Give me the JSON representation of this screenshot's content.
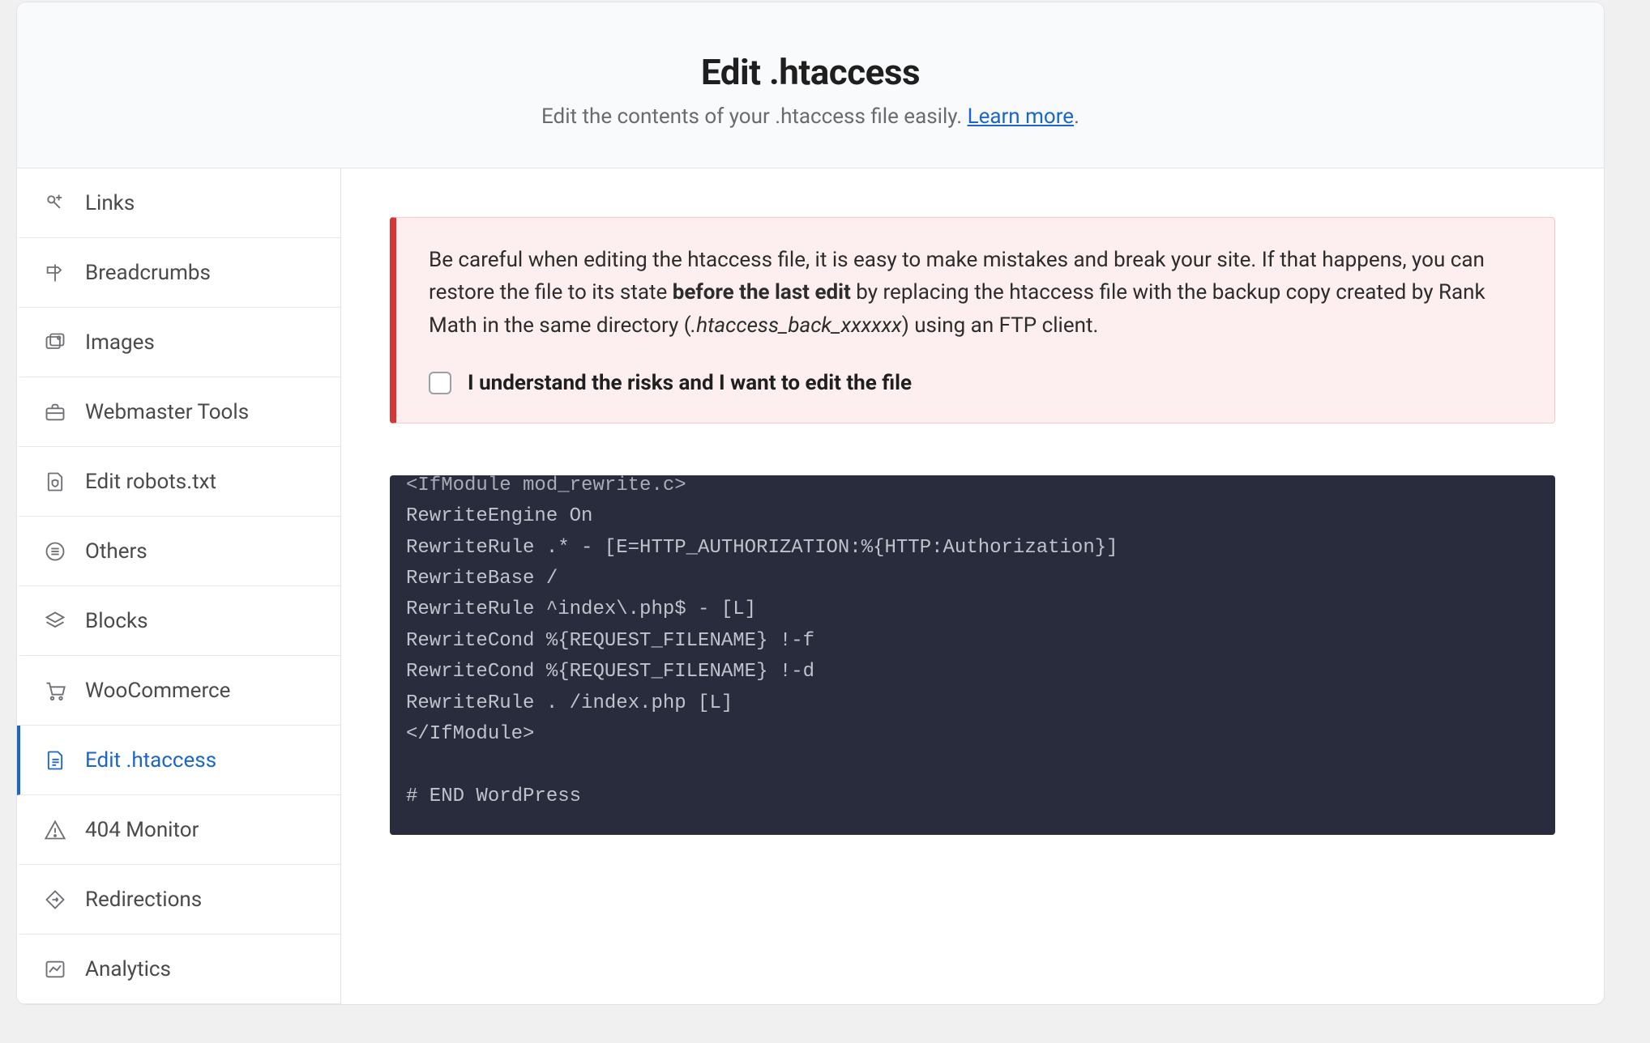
{
  "header": {
    "title": "Edit .htaccess",
    "subtitle_prefix": "Edit the contents of your .htaccess file easily. ",
    "learn_more": "Learn more",
    "subtitle_suffix": "."
  },
  "sidebar": {
    "items": [
      {
        "id": "links",
        "label": "Links"
      },
      {
        "id": "breadcrumbs",
        "label": "Breadcrumbs"
      },
      {
        "id": "images",
        "label": "Images"
      },
      {
        "id": "webmaster-tools",
        "label": "Webmaster Tools"
      },
      {
        "id": "edit-robots",
        "label": "Edit robots.txt"
      },
      {
        "id": "others",
        "label": "Others"
      },
      {
        "id": "blocks",
        "label": "Blocks"
      },
      {
        "id": "woocommerce",
        "label": "WooCommerce"
      },
      {
        "id": "edit-htaccess",
        "label": "Edit .htaccess"
      },
      {
        "id": "404-monitor",
        "label": "404 Monitor"
      },
      {
        "id": "redirections",
        "label": "Redirections"
      },
      {
        "id": "analytics",
        "label": "Analytics"
      }
    ],
    "active_id": "edit-htaccess"
  },
  "warning": {
    "text_before_bold": "Be careful when editing the htaccess file, it is easy to make mistakes and break your site. If that happens, you can restore the file to its state ",
    "bold_text": "before the last edit",
    "text_after_bold_before_italic": " by replacing the htaccess file with the backup copy created by Rank Math in the same directory (",
    "italic_text": ".htaccess_back_xxxxxx",
    "text_after_italic": ") using an FTP client.",
    "consent_label": "I understand the risks and I want to edit the file",
    "consent_checked": false
  },
  "editor": {
    "cut_first_line": "<IfModule mod_rewrite.c>",
    "body": "RewriteEngine On\nRewriteRule .* - [E=HTTP_AUTHORIZATION:%{HTTP:Authorization}]\nRewriteBase /\nRewriteRule ^index\\.php$ - [L]\nRewriteCond %{REQUEST_FILENAME} !-f\nRewriteCond %{REQUEST_FILENAME} !-d\nRewriteRule . /index.php [L]\n</IfModule>\n\n# END WordPress"
  },
  "icons": {
    "links": "links",
    "breadcrumbs": "signpost",
    "images": "images",
    "webmaster-tools": "briefcase",
    "edit-robots": "file-shield",
    "others": "list-circle",
    "blocks": "layers",
    "woocommerce": "cart",
    "edit-htaccess": "file-text",
    "404-monitor": "warning-triangle",
    "redirections": "diamond-arrow",
    "analytics": "chart-line"
  }
}
